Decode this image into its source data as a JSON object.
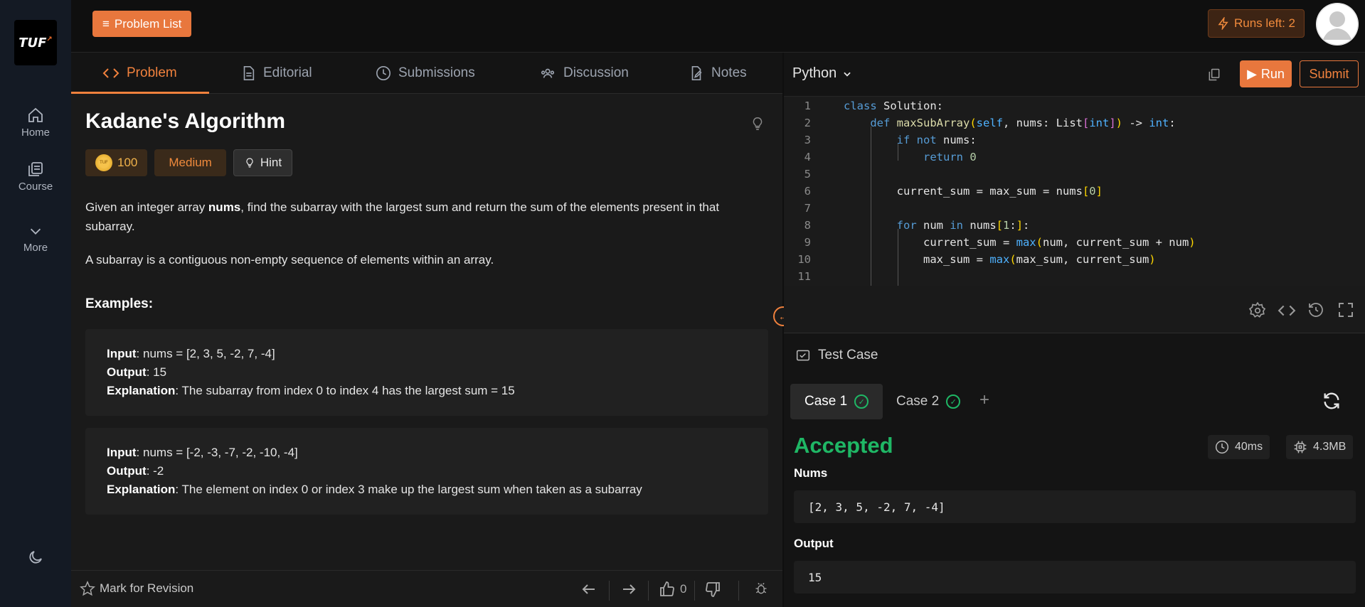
{
  "sidebar": {
    "logo": "TUF",
    "items": [
      {
        "label": "Home",
        "icon": "home-icon"
      },
      {
        "label": "Course",
        "icon": "course-icon"
      },
      {
        "label": "More",
        "icon": "chevron-down-icon"
      }
    ],
    "theme_icon": "moon-icon"
  },
  "topbar": {
    "problem_list_label": "Problem List",
    "runs_left_label": "Runs left: 2"
  },
  "tabs": [
    {
      "label": "Problem",
      "icon": "code-icon",
      "active": true
    },
    {
      "label": "Editorial",
      "icon": "document-icon",
      "active": false
    },
    {
      "label": "Submissions",
      "icon": "clock-icon",
      "active": false
    },
    {
      "label": "Discussion",
      "icon": "users-icon",
      "active": false
    },
    {
      "label": "Notes",
      "icon": "note-icon",
      "active": false
    }
  ],
  "problem": {
    "title": "Kadane's Algorithm",
    "coins": "100",
    "coin_text": "TUF",
    "difficulty": "Medium",
    "hint_label": "Hint",
    "description_pre": "Given an integer array ",
    "description_bold": "nums",
    "description_post": ", find the subarray with the largest sum and return the sum of the elements present in that subarray.",
    "description2": "A subarray is a contiguous non-empty sequence of elements within an array.",
    "examples_heading": "Examples:",
    "examples": [
      {
        "input_label": "Input",
        "input": ": nums = [2, 3, 5, -2, 7, -4]",
        "output_label": "Output",
        "output": ": 15",
        "explanation_label": "Explanation",
        "explanation": ": The subarray from index 0 to index 4 has the largest sum = 15"
      },
      {
        "input_label": "Input",
        "input": ": nums = [-2, -3, -7, -2, -10, -4]",
        "output_label": "Output",
        "output": ": -2",
        "explanation_label": "Explanation",
        "explanation": ": The element on index 0 or index 3 make up the largest sum when taken as a subarray"
      }
    ]
  },
  "bottom_bar": {
    "mark_label": "Mark for Revision",
    "likes": "0"
  },
  "editor": {
    "language": "Python",
    "run_label": "Run",
    "submit_label": "Submit",
    "line_numbers": [
      "1",
      "2",
      "3",
      "4",
      "5",
      "6",
      "7",
      "8",
      "9",
      "10",
      "11"
    ]
  },
  "testcase": {
    "heading": "Test Case",
    "cases": [
      "Case 1",
      "Case 2"
    ],
    "status": "Accepted",
    "runtime": "40ms",
    "memory": "4.3MB",
    "nums_label": "Nums",
    "nums_value": "[2, 3, 5, -2, 7, -4]",
    "output_label": "Output",
    "output_value": "15"
  },
  "colors": {
    "accent": "#e8773d",
    "success": "#1fb765",
    "background": "#0f0f0f"
  }
}
